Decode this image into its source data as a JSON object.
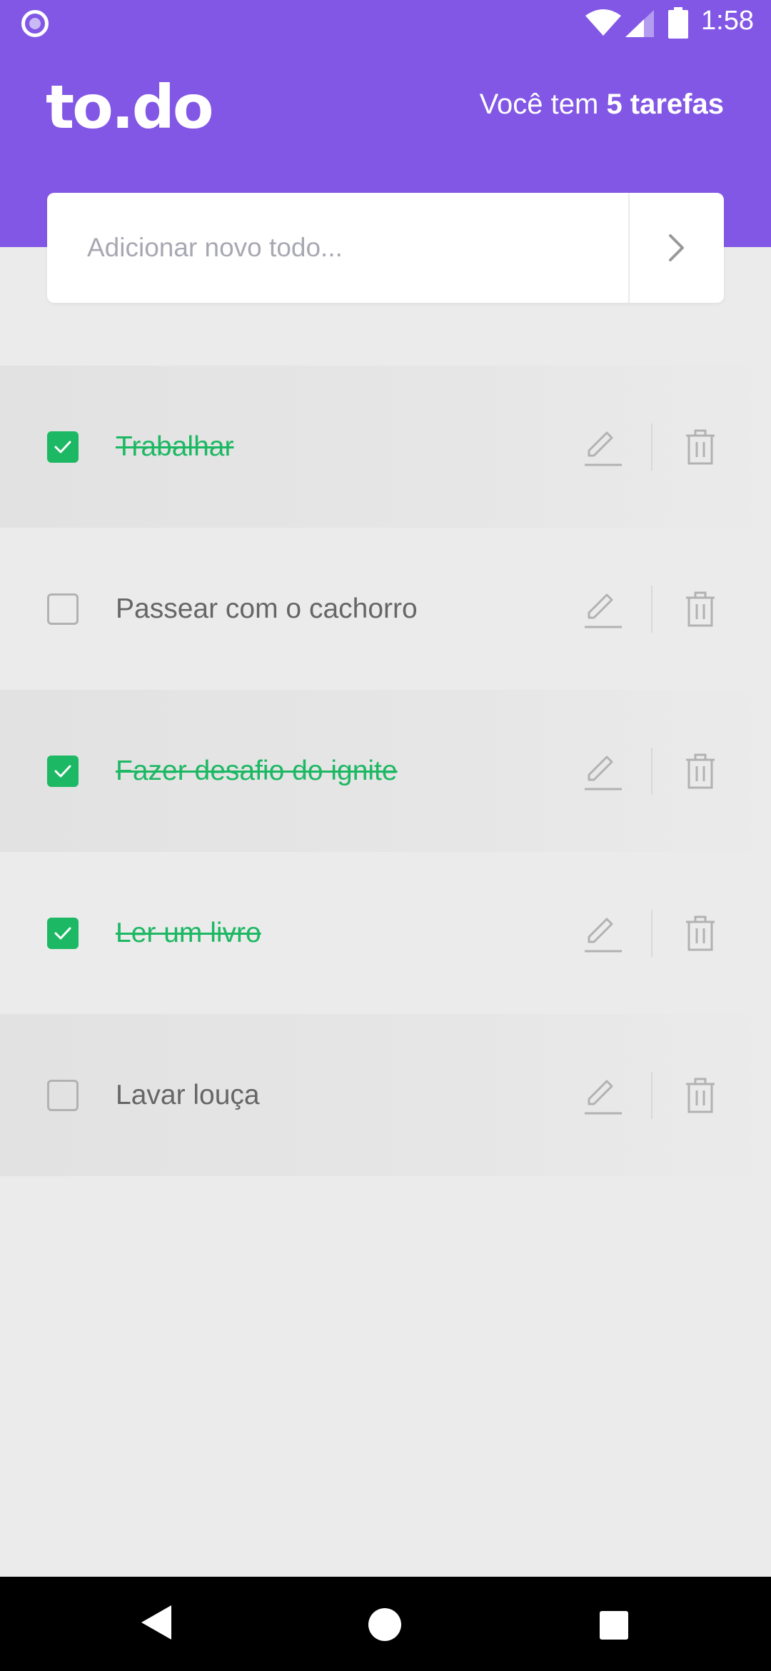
{
  "status_bar": {
    "time": "1:58"
  },
  "header": {
    "logo": "to.do",
    "count_prefix": "Você tem ",
    "count_value": "5 tarefas"
  },
  "add_todo": {
    "placeholder": "Adicionar novo todo..."
  },
  "todos": [
    {
      "label": "Trabalhar",
      "done": true
    },
    {
      "label": "Passear com o cachorro",
      "done": false
    },
    {
      "label": "Fazer desafio do ignite",
      "done": true
    },
    {
      "label": "Ler um livro",
      "done": true
    },
    {
      "label": "Lavar louça",
      "done": false
    }
  ],
  "colors": {
    "brand": "#8257e5",
    "done": "#1db863",
    "background": "#ebebeb"
  },
  "icons": [
    "pencil-icon",
    "trash-icon",
    "chevron-right-icon",
    "check-icon"
  ]
}
